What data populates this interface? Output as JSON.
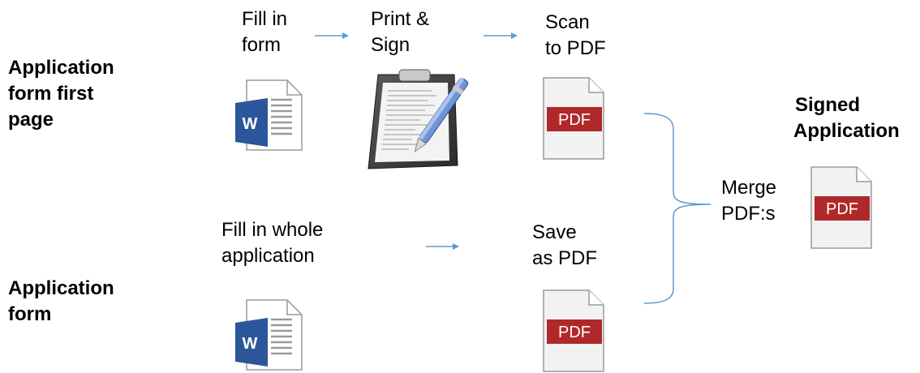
{
  "rows": [
    {
      "title_lines": [
        "Application",
        "form first",
        "page"
      ]
    },
    {
      "title_lines": [
        "Application",
        "form"
      ]
    }
  ],
  "steps": {
    "fill_form": [
      "Fill in",
      "form"
    ],
    "print_sign": [
      "Print &",
      "Sign"
    ],
    "scan_pdf": [
      "Scan",
      "to PDF"
    ],
    "fill_whole": [
      "Fill in whole",
      "application"
    ],
    "save_pdf": [
      "Save",
      "as PDF"
    ],
    "merge": [
      "Merge",
      "PDF:s"
    ]
  },
  "result": {
    "title_lines": [
      "Signed",
      "Application"
    ]
  },
  "icons": {
    "word_letter": "W",
    "pdf_label": "PDF"
  },
  "colors": {
    "arrow": "#5b9bd5",
    "word_blue": "#2b579a",
    "pdf_red": "#b0282a",
    "bracket": "#5b9bd5"
  }
}
